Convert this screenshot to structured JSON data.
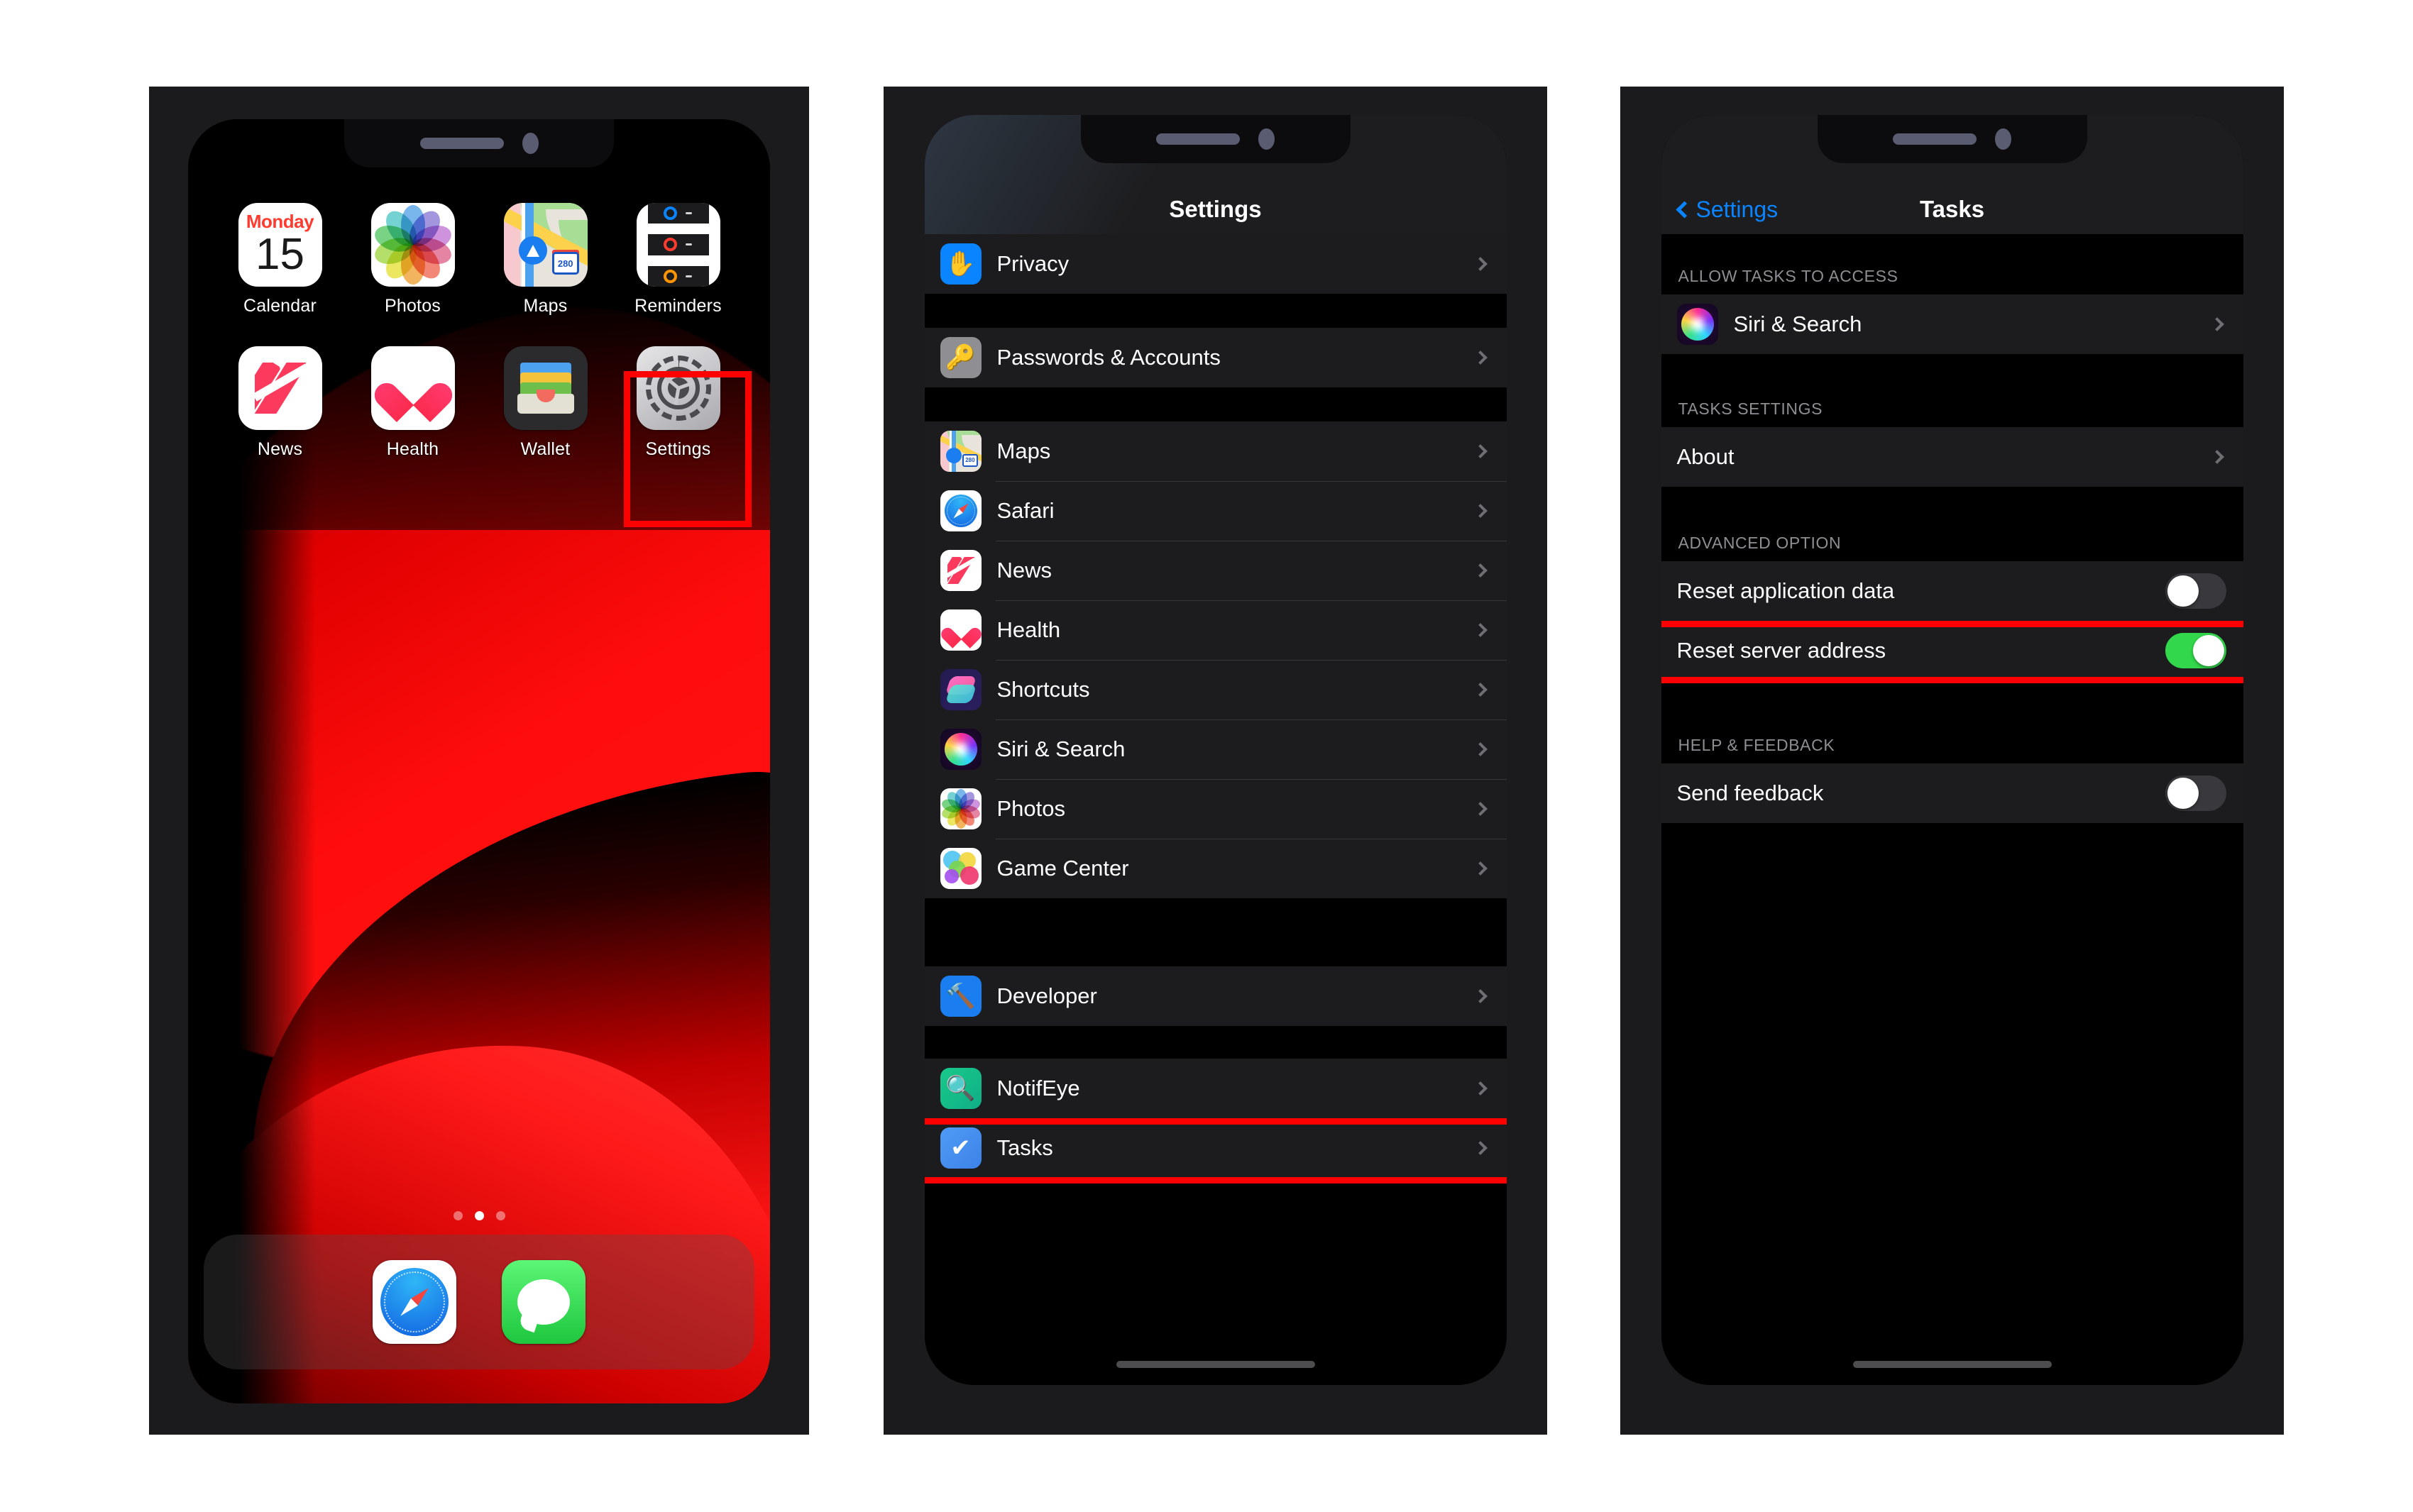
{
  "phones": [
    {
      "name": "home-screen",
      "type": "home",
      "apps_row1": [
        {
          "label": "Calendar",
          "icon": "calendar-icon",
          "day": "Monday",
          "date": "15"
        },
        {
          "label": "Photos",
          "icon": "photos-icon"
        },
        {
          "label": "Maps",
          "icon": "maps-icon",
          "shield": "280"
        },
        {
          "label": "Reminders",
          "icon": "reminders-icon"
        }
      ],
      "apps_row2": [
        {
          "label": "News",
          "icon": "news-icon"
        },
        {
          "label": "Health",
          "icon": "health-icon"
        },
        {
          "label": "Wallet",
          "icon": "wallet-icon"
        },
        {
          "label": "Settings",
          "icon": "settings-gear-icon",
          "highlighted": true
        }
      ],
      "dock": [
        {
          "label": "Safari",
          "icon": "safari-icon"
        },
        {
          "label": "Messages",
          "icon": "messages-icon"
        }
      ],
      "page_dots": {
        "count": 3,
        "active_index": 1
      }
    },
    {
      "name": "settings-list",
      "type": "settings",
      "nav": {
        "title": "Settings",
        "back_label": null
      },
      "groups": [
        {
          "rows": [
            {
              "label": "Privacy",
              "icon": "privacy-hand-icon",
              "accessory": "chevron"
            }
          ]
        },
        {
          "rows": [
            {
              "label": "Passwords & Accounts",
              "icon": "key-icon",
              "accessory": "chevron"
            }
          ]
        },
        {
          "rows": [
            {
              "label": "Maps",
              "icon": "maps-icon",
              "accessory": "chevron"
            },
            {
              "label": "Safari",
              "icon": "safari-icon",
              "accessory": "chevron"
            },
            {
              "label": "News",
              "icon": "news-icon",
              "accessory": "chevron"
            },
            {
              "label": "Health",
              "icon": "health-icon",
              "accessory": "chevron"
            },
            {
              "label": "Shortcuts",
              "icon": "shortcuts-icon",
              "accessory": "chevron"
            },
            {
              "label": "Siri & Search",
              "icon": "siri-icon",
              "accessory": "chevron"
            },
            {
              "label": "Photos",
              "icon": "photos-icon",
              "accessory": "chevron"
            },
            {
              "label": "Game Center",
              "icon": "game-center-icon",
              "accessory": "chevron"
            }
          ]
        },
        {
          "rows": [
            {
              "label": "Developer",
              "icon": "developer-hammer-icon",
              "accessory": "chevron"
            }
          ]
        },
        {
          "rows": [
            {
              "label": "NotifEye",
              "icon": "notifeye-icon",
              "accessory": "chevron"
            },
            {
              "label": "Tasks",
              "icon": "tasks-check-icon",
              "accessory": "chevron",
              "highlighted": true
            }
          ]
        }
      ]
    },
    {
      "name": "tasks-settings",
      "type": "settings",
      "nav": {
        "title": "Tasks",
        "back_label": "Settings"
      },
      "sections": [
        {
          "header": "ALLOW TASKS TO ACCESS",
          "rows": [
            {
              "label": "Siri & Search",
              "icon": "siri-icon",
              "accessory": "chevron"
            }
          ]
        },
        {
          "header": "TASKS SETTINGS",
          "rows": [
            {
              "label": "About",
              "accessory": "chevron"
            }
          ]
        },
        {
          "header": "ADVANCED OPTION",
          "rows": [
            {
              "label": "Reset application data",
              "accessory": "toggle",
              "toggle_on": false
            },
            {
              "label": "Reset server address",
              "accessory": "toggle",
              "toggle_on": true,
              "highlighted": true
            }
          ]
        },
        {
          "header": "HELP & FEEDBACK",
          "rows": [
            {
              "label": "Send feedback",
              "accessory": "toggle",
              "toggle_on": false
            }
          ]
        }
      ]
    }
  ],
  "colors": {
    "highlight_red": "#ff0000",
    "ios_blue": "#0a84ff",
    "toggle_on_green": "#32d74b",
    "row_bg": "#1c1c1e",
    "screen_bg": "#000000",
    "section_header_text": "#8e8e93"
  }
}
